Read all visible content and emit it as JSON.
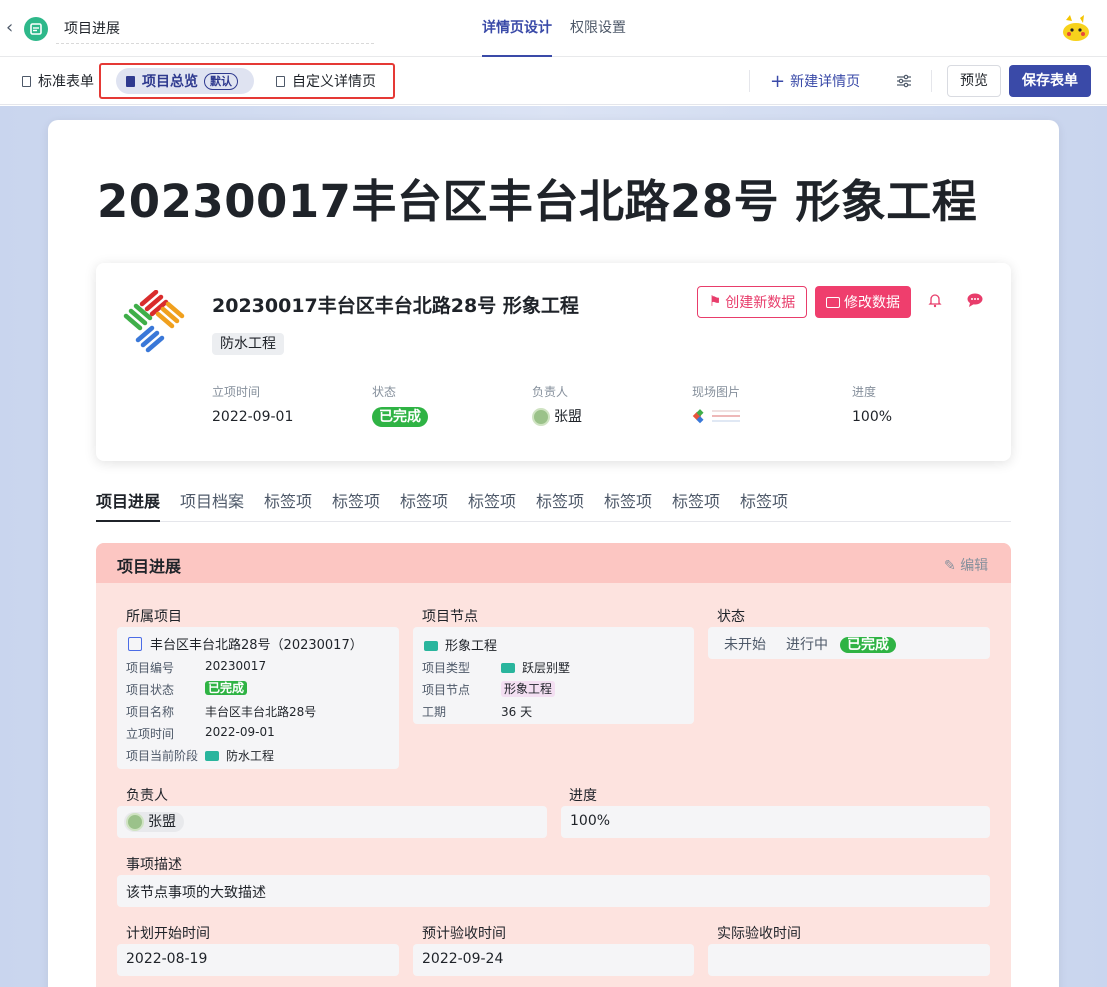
{
  "header": {
    "app_title": "项目进展",
    "tabs": [
      {
        "label": "详情页设计",
        "active": true
      },
      {
        "label": "权限设置",
        "active": false
      }
    ]
  },
  "toolbar": {
    "standard_form": "标准表单",
    "overview": "项目总览",
    "default_badge": "默认",
    "custom_detail": "自定义详情页",
    "new_detail": "新建详情页",
    "preview": "预览",
    "save": "保存表单"
  },
  "page": {
    "big_title": "20230017丰台区丰台北路28号 形象工程"
  },
  "summary_card": {
    "title": "20230017丰台区丰台北路28号 形象工程",
    "tag": "防水工程",
    "btn_create": "创建新数据",
    "btn_edit": "修改数据",
    "fields": [
      {
        "label": "立项时间",
        "value": "2022-09-01"
      },
      {
        "label": "状态",
        "value": "已完成"
      },
      {
        "label": "负责人",
        "value": "张盟"
      },
      {
        "label": "现场图片",
        "value": ""
      },
      {
        "label": "进度",
        "value": "100%"
      }
    ]
  },
  "tabs": [
    "项目进展",
    "项目档案",
    "标签项",
    "标签项",
    "标签项",
    "标签项",
    "标签项",
    "标签项",
    "标签项",
    "标签项"
  ],
  "panel": {
    "title": "项目进展",
    "edit": "编辑",
    "project": {
      "label": "所属项目",
      "name": "丰台区丰台北路28号（20230017）",
      "rows": [
        {
          "k": "项目编号",
          "v": "20230017"
        },
        {
          "k": "项目状态",
          "v": "已完成"
        },
        {
          "k": "项目名称",
          "v": "丰台区丰台北路28号"
        },
        {
          "k": "立项时间",
          "v": "2022-09-01"
        },
        {
          "k": "项目当前阶段",
          "v": "防水工程"
        }
      ]
    },
    "node": {
      "label": "项目节点",
      "name": "形象工程",
      "rows": [
        {
          "k": "项目类型",
          "v": "跃层别墅"
        },
        {
          "k": "项目节点",
          "v": "形象工程"
        },
        {
          "k": "工期",
          "v": "36 天"
        }
      ]
    },
    "status": {
      "label": "状态",
      "options": [
        "未开始",
        "进行中",
        "已完成"
      ],
      "selected": "已完成"
    },
    "owner": {
      "label": "负责人",
      "value": "张盟"
    },
    "progress": {
      "label": "进度",
      "value": "100%"
    },
    "desc": {
      "label": "事项描述",
      "value": "该节点事项的大致描述"
    },
    "plan_start": {
      "label": "计划开始时间",
      "value": "2022-08-19"
    },
    "expected_accept": {
      "label": "预计验收时间",
      "value": "2022-09-24"
    },
    "actual_accept": {
      "label": "实际验收时间",
      "value": ""
    }
  },
  "colors": {
    "primary": "#3a4aa8",
    "danger": "#ef3e6d",
    "success": "#2fb344",
    "panel_bg": "#fde3df",
    "panel_head": "#fcc6c2"
  }
}
